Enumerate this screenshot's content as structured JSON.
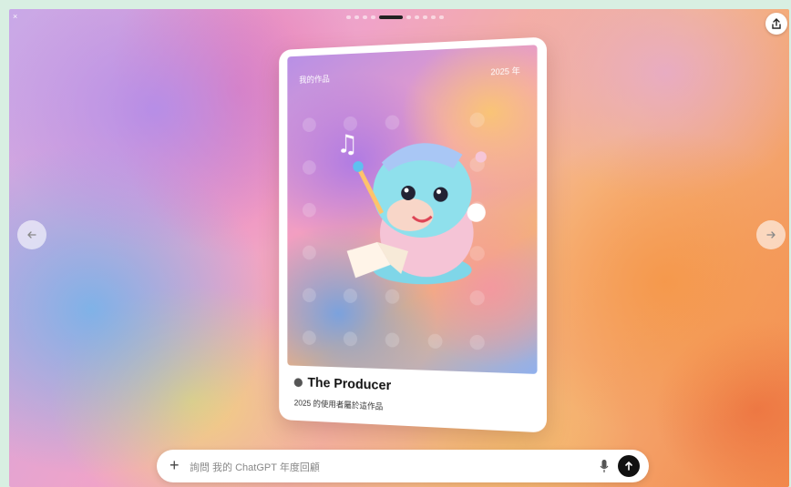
{
  "corner_label": "×",
  "pager": {
    "count": 10,
    "active_index": 4
  },
  "card": {
    "top_left_label": "我的作品",
    "top_right_label": "2025 年",
    "title": "The Producer",
    "subtitle": "2025 的使用者屬於這作品"
  },
  "chat": {
    "placeholder": "詢問 我的 ChatGPT 年度回顧"
  },
  "icons": {
    "share": "share-icon",
    "prev": "arrow-left-icon",
    "next": "arrow-right-icon",
    "plus": "plus-icon",
    "mic": "mic-icon",
    "send": "send-icon"
  },
  "colors": {
    "accent": "#111111",
    "card_bg": "#ffffff"
  }
}
